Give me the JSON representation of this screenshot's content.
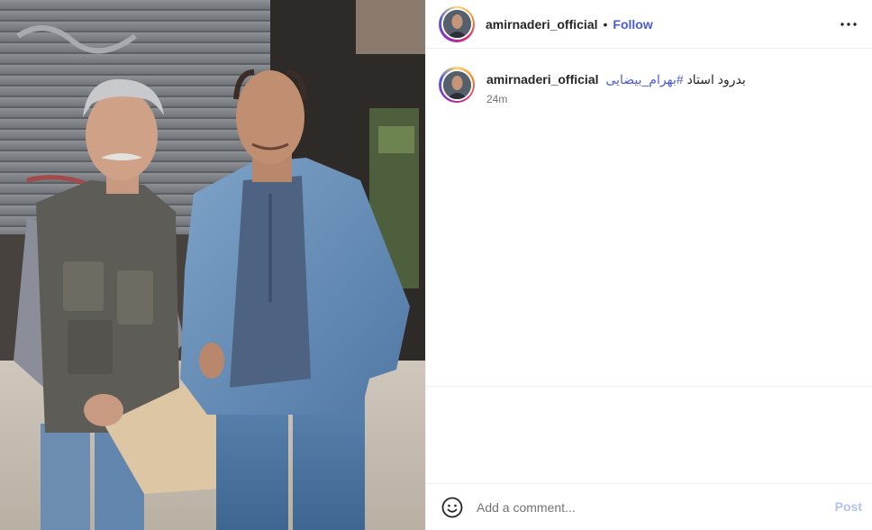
{
  "post": {
    "username": "amirnaderi_official",
    "dot": "•",
    "follow_label": "Follow",
    "more_icon": "more-horizontal-icon"
  },
  "caption": {
    "username": "amirnaderi_official",
    "text": "بدرود استاد ",
    "hashtag": "#بهرام_بیضایی",
    "timestamp": "24m"
  },
  "comment": {
    "placeholder": "Add a comment...",
    "post_label": "Post",
    "emoji_icon": "smiley-icon"
  },
  "colors": {
    "link": "#4a5bd8",
    "post_disabled": "#b3c3f5",
    "muted": "#737373",
    "border": "#efefef"
  }
}
